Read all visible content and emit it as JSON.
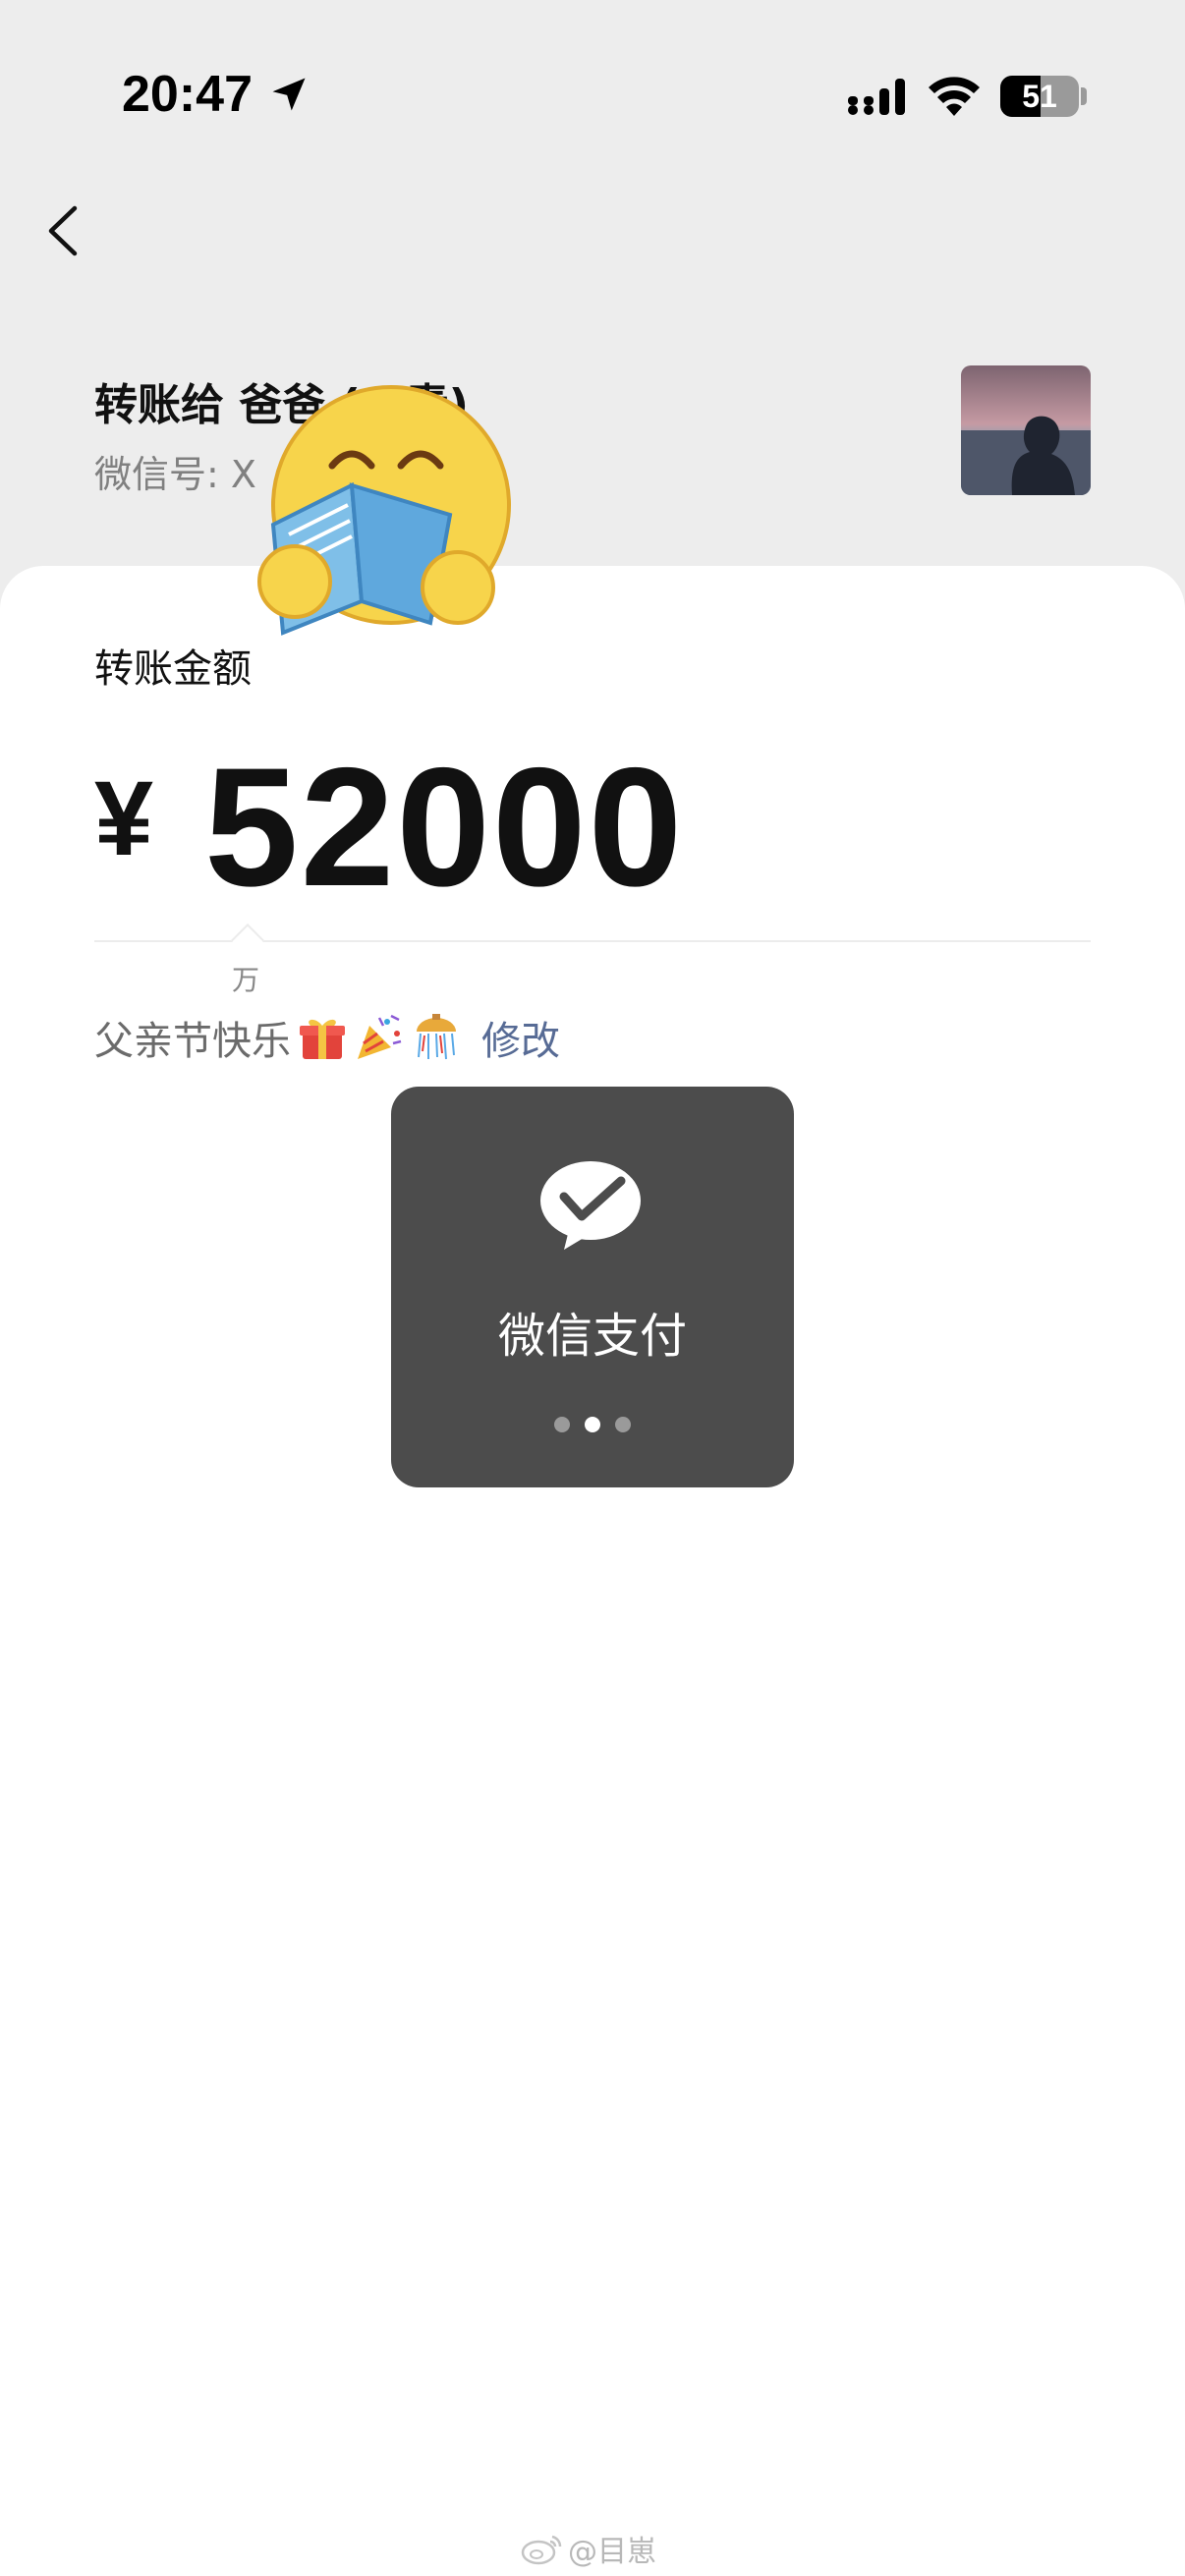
{
  "status_bar": {
    "time": "20:47",
    "battery_level": "51",
    "battery_fraction": 0.51,
    "icons": [
      "location-arrow-icon",
      "signal-icon",
      "wifi-icon",
      "battery-icon"
    ]
  },
  "nav": {
    "back_icon": "chevron-left-icon"
  },
  "recipient": {
    "title": "转账给 爸爸 (**青)",
    "wechat_id": "微信号: X"
  },
  "transfer": {
    "amount_label": "转账金额",
    "currency": "¥",
    "amount": "52000",
    "unit_hint": "万"
  },
  "remark": {
    "text": "父亲节快乐",
    "emojis": [
      "gift-emoji",
      "party-popper-emoji",
      "confetti-ball-emoji"
    ],
    "edit_label": "修改"
  },
  "toast": {
    "icon": "wechat-pay-icon",
    "text": "微信支付",
    "active_dot": 2,
    "dot_count": 3
  },
  "sticker": {
    "icon": "reading-smiley-sticker"
  },
  "watermark": {
    "text": "@目崽"
  },
  "colors": {
    "background": "#ededed",
    "card": "#ffffff",
    "link": "#576b95",
    "toast": "#4c4c4c",
    "remark_text": "#6b6b6b"
  }
}
